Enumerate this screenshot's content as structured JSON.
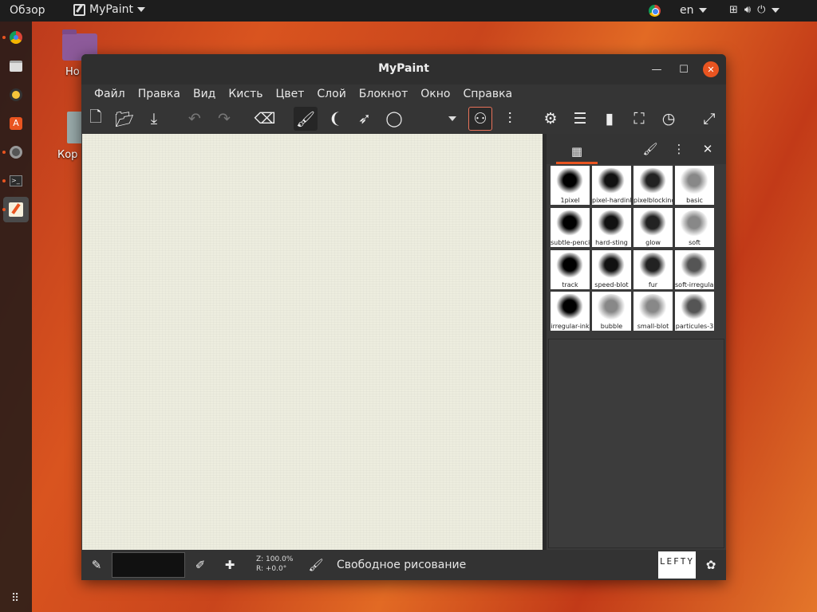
{
  "topbar": {
    "activities": "Обзор",
    "app_name": "MyPaint",
    "language": "en"
  },
  "desktop": {
    "home_label": "Но",
    "trash_label": "Кор"
  },
  "window": {
    "title": "MyPaint"
  },
  "menu": [
    "Файл",
    "Правка",
    "Вид",
    "Кисть",
    "Цвет",
    "Слой",
    "Блокнот",
    "Окно",
    "Справка"
  ],
  "toolbar_icons": [
    "new-document",
    "open-file",
    "save-file",
    "undo",
    "redo",
    "eraser",
    "freehand-brush",
    "inking",
    "connected-lines",
    "ellipse",
    "dropdown",
    "color-circles",
    "brush-set",
    "settings",
    "layers",
    "scratchpad",
    "fullscreen",
    "history",
    "expand"
  ],
  "brushes": [
    {
      "name": "1pixel"
    },
    {
      "name": "pixel-hardink"
    },
    {
      "name": "pixelblocking"
    },
    {
      "name": "basic"
    },
    {
      "name": "subtle-pencil"
    },
    {
      "name": "hard-sting"
    },
    {
      "name": "glow"
    },
    {
      "name": "soft"
    },
    {
      "name": "track"
    },
    {
      "name": "speed-blot"
    },
    {
      "name": "fur"
    },
    {
      "name": "soft-irregular"
    },
    {
      "name": "irregular-ink"
    },
    {
      "name": "bubble"
    },
    {
      "name": "small-blot"
    },
    {
      "name": "particules-3"
    }
  ],
  "status": {
    "zoom": "Z: 100.0%",
    "rotation": "R: +0.0°",
    "mode": "Свободное рисование",
    "lefty": "LEFTY"
  },
  "colors": {
    "accent": "#e95420",
    "canvas": "#ededdf",
    "current_color": "#111111"
  }
}
